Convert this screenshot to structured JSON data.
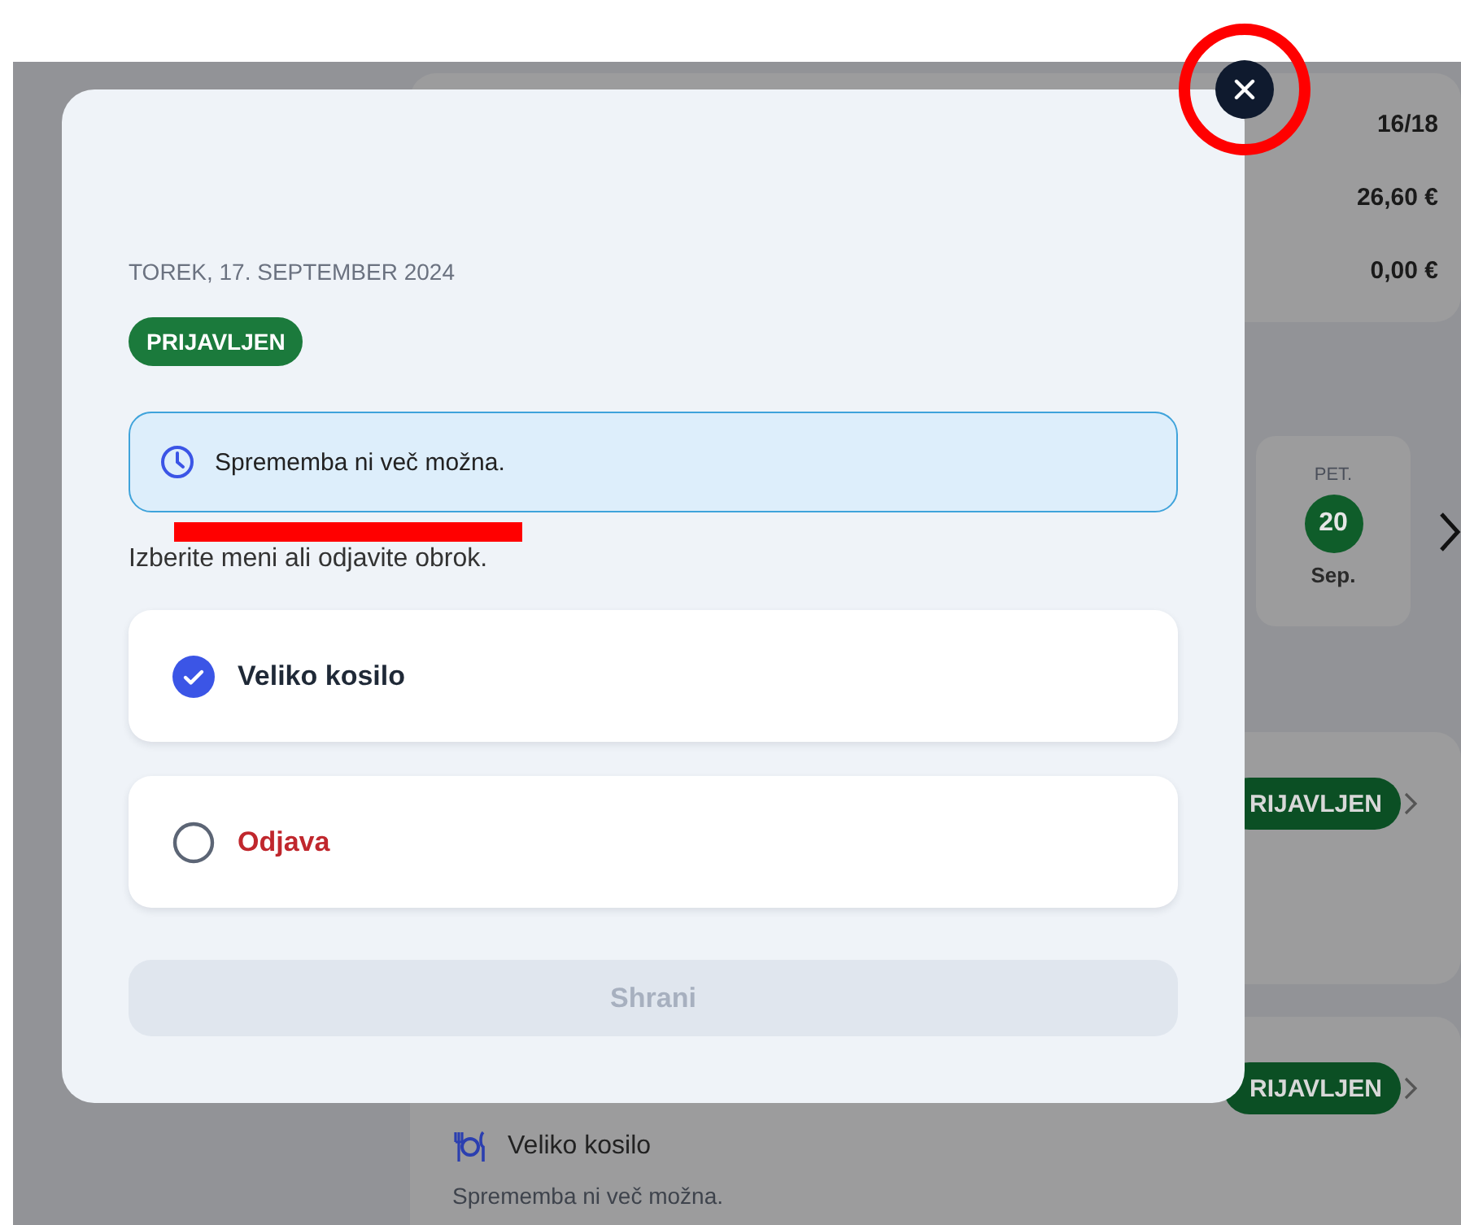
{
  "background": {
    "summary_values": [
      "16/18",
      "26,60 €",
      "0,00 €"
    ],
    "day": {
      "weekday": "PET.",
      "day": "20",
      "month": "Sep."
    },
    "meals": [
      {
        "badge": "RIJAVLJEN"
      },
      {
        "badge": "RIJAVLJEN",
        "meal": "Veliko kosilo",
        "note": "Sprememba ni več možna."
      }
    ]
  },
  "modal": {
    "date": "TOREK, 17. SEPTEMBER 2024",
    "status": "PRIJAVLJEN",
    "notice": "Sprememba ni več možna.",
    "instruction": "Izberite meni ali odjavite obrok.",
    "options": [
      {
        "label": "Veliko kosilo",
        "selected": true,
        "kind": "menu"
      },
      {
        "label": "Odjava",
        "selected": false,
        "kind": "cancel"
      }
    ],
    "save_button": {
      "label": "Shrani",
      "disabled": true
    }
  }
}
